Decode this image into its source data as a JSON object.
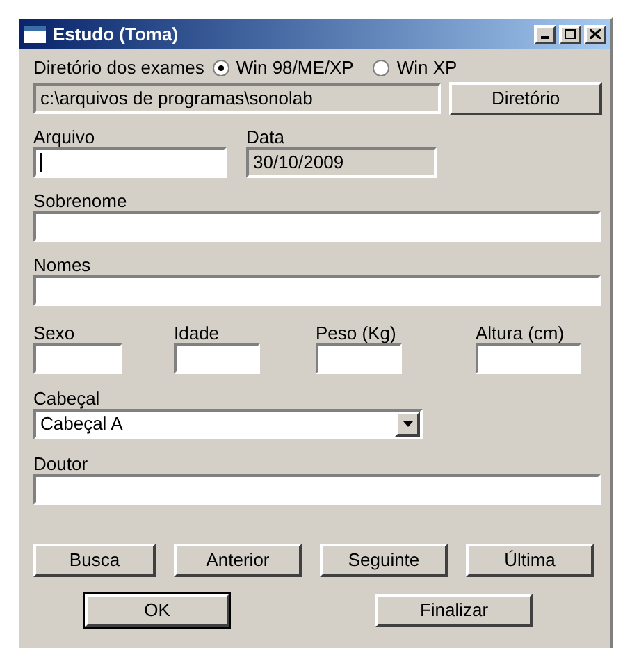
{
  "window": {
    "title": "Estudo (Toma)"
  },
  "directory": {
    "label": "Diretório dos exames",
    "options": [
      {
        "label": "Win 98/ME/XP",
        "selected": true
      },
      {
        "label": "Win XP",
        "selected": false
      }
    ],
    "path": "c:\\arquivos de programas\\sonolab",
    "button": "Diretório"
  },
  "arquivo": {
    "label": "Arquivo",
    "focused": true
  },
  "data": {
    "label": "Data",
    "value": "30/10/2009"
  },
  "sobrenome": {
    "label": "Sobrenome"
  },
  "nomes": {
    "label": "Nomes"
  },
  "small_fields": [
    {
      "label": "Sexo"
    },
    {
      "label": "Idade"
    },
    {
      "label": "Peso (Kg)"
    },
    {
      "label": "Altura (cm)"
    }
  ],
  "cabecal": {
    "label": "Cabeçal",
    "value": "Cabeçal A"
  },
  "doutor": {
    "label": "Doutor"
  },
  "nav_buttons": [
    "Busca",
    "Anterior",
    "Seguinte",
    "Última"
  ],
  "ok_button": {
    "label": "OK",
    "default": true
  },
  "finish_button": {
    "label": "Finalizar",
    "default": false
  }
}
